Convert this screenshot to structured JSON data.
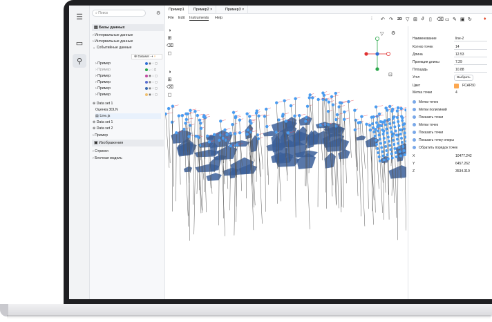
{
  "sidebar": {
    "search_placeholder": "Поиск",
    "title": "Базы данных",
    "tree": [
      {
        "label": "Интервальные данные",
        "type": "group"
      },
      {
        "label": "Интервальные данные",
        "type": "group"
      },
      {
        "label": "Событийные данные",
        "type": "group-open"
      },
      {
        "label": "Пример"
      },
      {
        "label": "Пример"
      },
      {
        "label": "Пример"
      },
      {
        "label": "Пример"
      },
      {
        "label": "Пример"
      },
      {
        "label": "Пример"
      }
    ],
    "popup_label": "Dataset",
    "datasets": [
      {
        "label": "Data set 1"
      },
      {
        "label": "Оценка 3DLN"
      },
      {
        "label": "Line.js"
      },
      {
        "label": "Data set 1"
      },
      {
        "label": "Data set 2"
      },
      {
        "label": "Пример"
      }
    ],
    "images_label": "Изображения",
    "strings_label": "Стринги",
    "block_model_label": "Блочная модель"
  },
  "tabs": [
    {
      "label": "Пример1"
    },
    {
      "label": "Пример2"
    },
    {
      "label": "Пример3"
    }
  ],
  "menu": {
    "file": "File",
    "edit": "Edit",
    "instruments": "Instruments",
    "help": "Help"
  },
  "toolbar": {
    "mode_2d": "2D"
  },
  "props": {
    "name_label": "Наименование",
    "name_value": "line-2",
    "points_label": "Кол-во точек",
    "points_value": "14",
    "length_label": "Длина",
    "length_value": "12.53",
    "proj_length_label": "Проекция длины",
    "proj_length_value": "7.29",
    "area_label": "Площадь",
    "area_value": "10.88",
    "angle_label": "Угол",
    "angle_button": "Выбрать",
    "color_label": "Цвет",
    "color_value": "FCAF50",
    "point_label_label": "Метка точки",
    "point_label_value": "4",
    "options": [
      "Метки точек",
      "Метки полилиний",
      "Показать точки",
      "Метки точек",
      "Показать точки",
      "Показать точку опоры",
      "Обратить порядок точек"
    ],
    "x_label": "X",
    "x_value": "10477.242",
    "y_label": "Y",
    "y_value": "6457.262",
    "z_label": "Z",
    "z_value": "3534.319"
  },
  "colors": {
    "accent": "#2f6fd6",
    "points": "#4a9cf0",
    "surface": "#3b5f9a",
    "swatch": "#FCAF50"
  }
}
